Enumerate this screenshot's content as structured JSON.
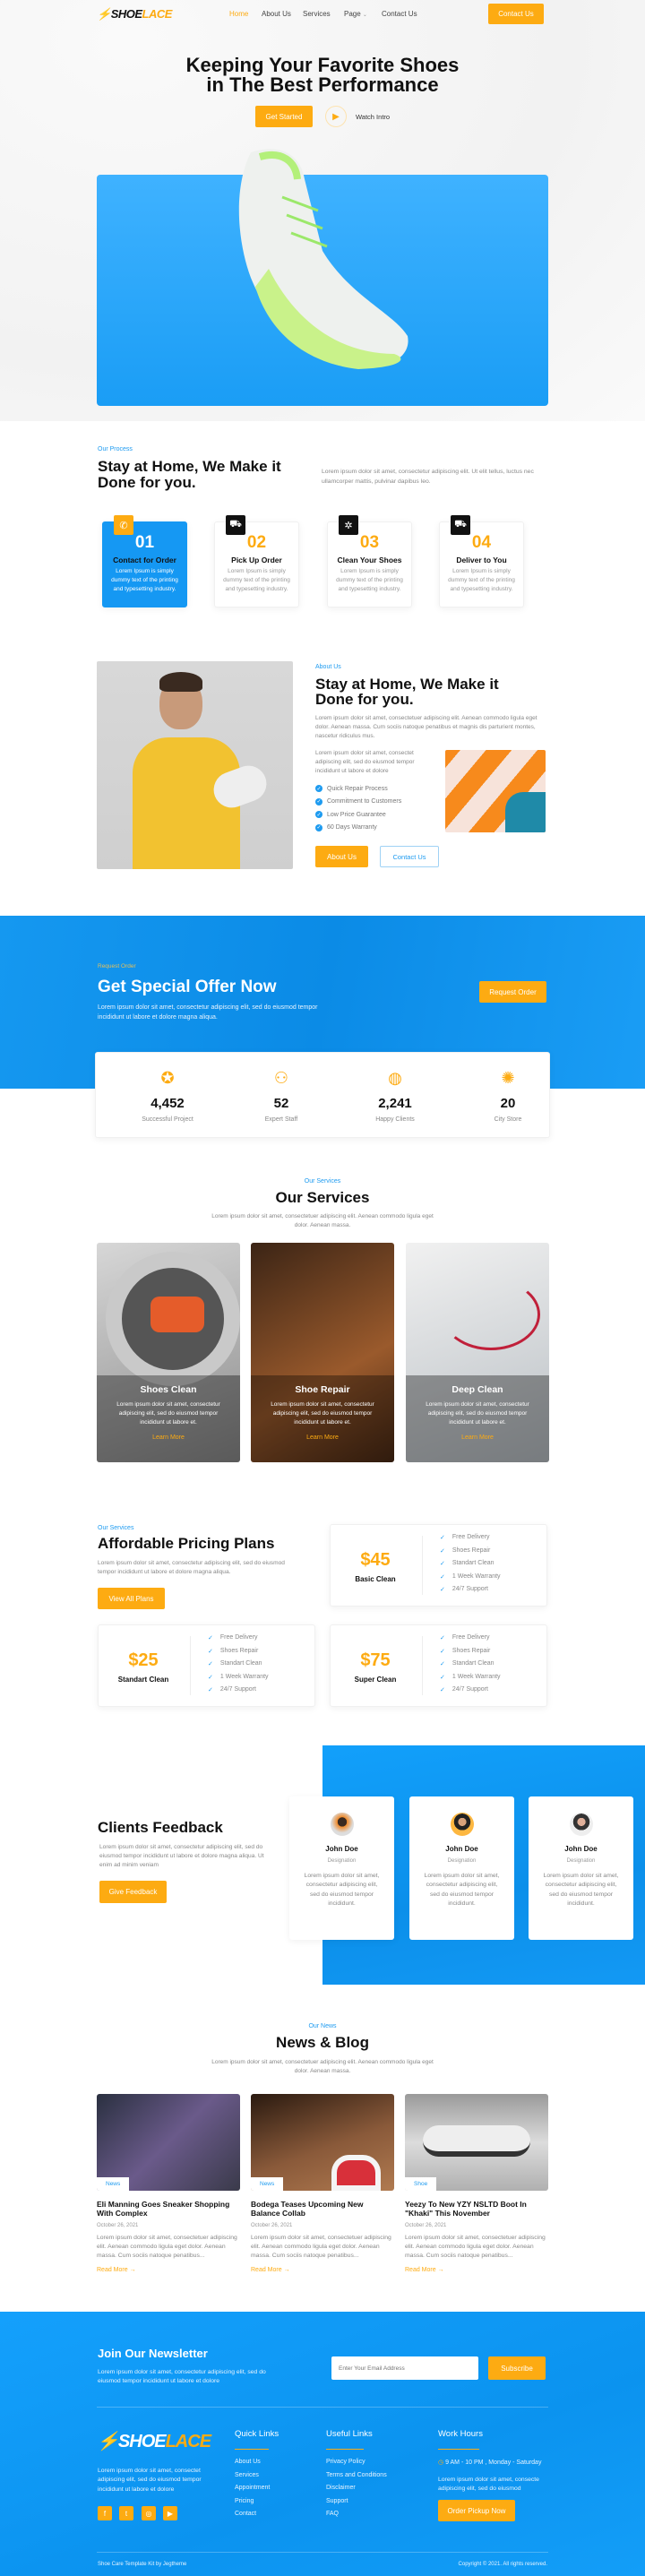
{
  "brand": {
    "logo_text_1": "SHOE",
    "logo_text_2": "LACE",
    "accent": "#FDAB12",
    "primary": "#1E9BF0"
  },
  "nav": {
    "items": [
      {
        "label": "Home",
        "active": true
      },
      {
        "label": "About Us"
      },
      {
        "label": "Services"
      },
      {
        "label": "Page",
        "dropdown": true
      },
      {
        "label": "Contact Us"
      }
    ],
    "cta": "Contact Us"
  },
  "hero": {
    "title_line1": "Keeping Your Favorite Shoes",
    "title_line2": "in The Best Performance",
    "get_started": "Get Started",
    "watch_intro": "Watch Intro",
    "play_icon": "play-icon"
  },
  "process": {
    "tag": "Our Process",
    "title_line1": "Stay at Home, We Make it",
    "title_line2": "Done for you.",
    "desc": "Lorem ipsum dolor sit amet, consectetur adipiscing elit. Ut elit tellus, luctus nec ullamcorper mattis, pulvinar dapibus leo.",
    "steps": [
      {
        "num": "01",
        "title": "Contact for Order",
        "desc": "Lorem Ipsum is simply dummy text of the printing and typesetting industry.",
        "icon": "phone-icon",
        "active": true
      },
      {
        "num": "02",
        "title": "Pick Up Order",
        "desc": "Lorem Ipsum is simply dummy text of the printing and typesetting industry.",
        "icon": "truck-icon"
      },
      {
        "num": "03",
        "title": "Clean Your Shoes",
        "desc": "Lorem Ipsum is simply dummy text of the printing and typesetting industry.",
        "icon": "wash-icon"
      },
      {
        "num": "04",
        "title": "Deliver to You",
        "desc": "Lorem Ipsum is simply dummy text of the printing and typesetting industry.",
        "icon": "truck-icon"
      }
    ]
  },
  "about": {
    "tag": "About Us",
    "title_line1": "Stay at Home, We Make it",
    "title_line2": "Done for you.",
    "desc1": "Lorem ipsum dolor sit amet, consectetuer adipiscing elit. Aenean commodo ligula eget dolor. Aenean massa. Cum sociis natoque penatibus et magnis dis parturient montes, nascetur ridiculus mus.",
    "desc2": "Lorem ipsum dolor sit amet, consectet adipiscing elit, sed do eiusmod tempor incididunt ut labore et dolore",
    "features": [
      "Quick Repair Process",
      "Commitment to Customers",
      "Low Price Guarantee",
      "60 Days Warranty"
    ],
    "about_btn": "About Us",
    "contact_btn": "Contact Us"
  },
  "offer": {
    "tag": "Request Order",
    "title": "Get Special Offer Now",
    "desc": "Lorem ipsum dolor sit amet, consectetur adipiscing elit, sed do eiusmod tempor incididunt ut labore et dolore magna aliqua.",
    "button": "Request Order",
    "stats": [
      {
        "value": "4,452",
        "label": "Successful Project",
        "icon": "award-icon"
      },
      {
        "value": "52",
        "label": "Expert Staff",
        "icon": "team-icon"
      },
      {
        "value": "2,241",
        "label": "Happy Clients",
        "icon": "globe-icon"
      },
      {
        "value": "20",
        "label": "City Store",
        "icon": "store-icon"
      }
    ]
  },
  "services": {
    "tag": "Our Services",
    "title": "Our Services",
    "desc": "Lorem ipsum dolor sit amet, consectetuer adipiscing elit. Aenean commodo ligula eget dolor. Aenean massa.",
    "items": [
      {
        "title": "Shoes Clean",
        "desc": "Lorem ipsum dolor sit amet, consectetur adipiscing elit, sed do eiusmod tempor incididunt ut labore et.",
        "link": "Learn More"
      },
      {
        "title": "Shoe Repair",
        "desc": "Lorem ipsum dolor sit amet, consectetur adipiscing elit, sed do eiusmod tempor incididunt ut labore et.",
        "link": "Learn More"
      },
      {
        "title": "Deep Clean",
        "desc": "Lorem ipsum dolor sit amet, consectetur adipiscing elit, sed do eiusmod tempor incididunt ut labore et.",
        "link": "Learn More"
      }
    ]
  },
  "pricing": {
    "tag": "Our Services",
    "title": "Affordable Pricing Plans",
    "desc": "Lorem ipsum dolor sit amet, consectetur adipiscing elit, sed do eiusmod tempor incididunt ut labore et dolore magna aliqua.",
    "button": "View All Plans",
    "plans": [
      {
        "price": "$45",
        "name": "Basic Clean",
        "features": [
          "Free Delivery",
          "Shoes Repair",
          "Standart Clean",
          "1 Week Warranty",
          "24/7 Support"
        ]
      },
      {
        "price": "$25",
        "name": "Standart Clean",
        "features": [
          "Free Delivery",
          "Shoes Repair",
          "Standart Clean",
          "1 Week Warranty",
          "24/7 Support"
        ]
      },
      {
        "price": "$75",
        "name": "Super Clean",
        "features": [
          "Free Delivery",
          "Shoes Repair",
          "Standart Clean",
          "1 Week Warranty",
          "24/7 Support"
        ]
      }
    ]
  },
  "feedback": {
    "title": "Clients Feedback",
    "desc": "Lorem ipsum dolor sit amet, consectetur adipiscing elit, sed do eiusmod tempor incididunt ut labore et dolore magna aliqua. Ut enim ad minim veniam",
    "button": "Give Feedback",
    "items": [
      {
        "name": "John Doe",
        "role": "Designation",
        "text": "Lorem ipsum dolor sit amet, consectetur adipiscing elit, sed do eiusmod tempor incididunt."
      },
      {
        "name": "John Doe",
        "role": "Designation",
        "text": "Lorem ipsum dolor sit amet, consectetur adipiscing elit, sed do eiusmod tempor incididunt."
      },
      {
        "name": "John Doe",
        "role": "Designation",
        "text": "Lorem ipsum dolor sit amet, consectetur adipiscing elit, sed do eiusmod tempor incididunt."
      }
    ]
  },
  "news": {
    "tag": "Our News",
    "title": "News & Blog",
    "desc": "Lorem ipsum dolor sit amet, consectetuer adipiscing elit. Aenean commodo ligula eget dolor. Aenean massa.",
    "items": [
      {
        "tag": "News",
        "title": "Eli Manning Goes Sneaker Shopping With Complex",
        "date": "October 26, 2021",
        "excerpt": "Lorem ipsum dolor sit amet, consectetuer adipiscing elit. Aenean commodo ligula eget dolor. Aenean massa. Cum sociis natoque penatibus...",
        "link": "Read More →"
      },
      {
        "tag": "News",
        "title": "Bodega Teases Upcoming New Balance Collab",
        "date": "October 26, 2021",
        "excerpt": "Lorem ipsum dolor sit amet, consectetuer adipiscing elit. Aenean commodo ligula eget dolor. Aenean massa. Cum sociis natoque penatibus...",
        "link": "Read More →"
      },
      {
        "tag": "Shoe",
        "title": "Yeezy To New YZY NSLTD Boot In \"Khaki\" This November",
        "date": "October 26, 2021",
        "excerpt": "Lorem ipsum dolor sit amet, consectetuer adipiscing elit. Aenean commodo ligula eget dolor. Aenean massa. Cum sociis natoque penatibus...",
        "link": "Read More →"
      }
    ]
  },
  "newsletter": {
    "title": "Join Our Newsletter",
    "desc": "Lorem ipsum dolor sit amet, consectetur adipiscing elit, sed do eiusmod tempor incididunt ut labore et dolore",
    "placeholder": "Enter Your Email Address",
    "button": "Subscribe"
  },
  "footer": {
    "about": "Lorem ipsum dolor sit amet, consectet adipiscing elit, sed do eiusmod tempor incididunt ut labore et dolore",
    "social": [
      "facebook-icon",
      "twitter-icon",
      "instagram-icon",
      "youtube-icon"
    ],
    "quick_title": "Quick Links",
    "quick": [
      "About Us",
      "Services",
      "Appointment",
      "Pricing",
      "Contact"
    ],
    "useful_title": "Useful Links",
    "useful": [
      "Privacy Policy",
      "Terms and Conditions",
      "Disclaimer",
      "Support",
      "FAQ"
    ],
    "hours_title": "Work Hours",
    "hours": "9 AM - 10 PM , Monday - Saturday",
    "hours_desc": "Lorem ipsum dolor sit amet, consecte adipiscing elit, sed do eiusmod",
    "hours_btn": "Order Pickup Now",
    "credit": "Shoe Care Template Kit by Jegtheme",
    "copyright": "Copyright © 2021. All rights reserved."
  }
}
